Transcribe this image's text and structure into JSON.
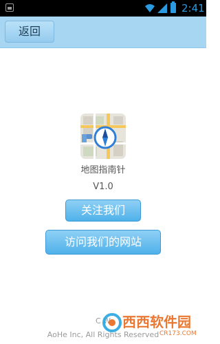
{
  "status_bar": {
    "time": "2:41"
  },
  "header": {
    "back_label": "返回"
  },
  "app": {
    "name": "地图指南针",
    "version": "V1.0",
    "icon": "map-compass-icon"
  },
  "actions": {
    "follow_label": "关注我们",
    "visit_label": "访问我们的网站"
  },
  "footer": {
    "line1": "C  W",
    "line2": "AoHe Inc, All Rights Reserved"
  },
  "watermark": {
    "brand": "西西软件园",
    "url": "CR173.COM"
  },
  "colors": {
    "title_bar": "#a7d6f3",
    "button_blue": "#4fb1ea",
    "status_accent": "#2a9be0",
    "watermark": "#e86a1c"
  }
}
